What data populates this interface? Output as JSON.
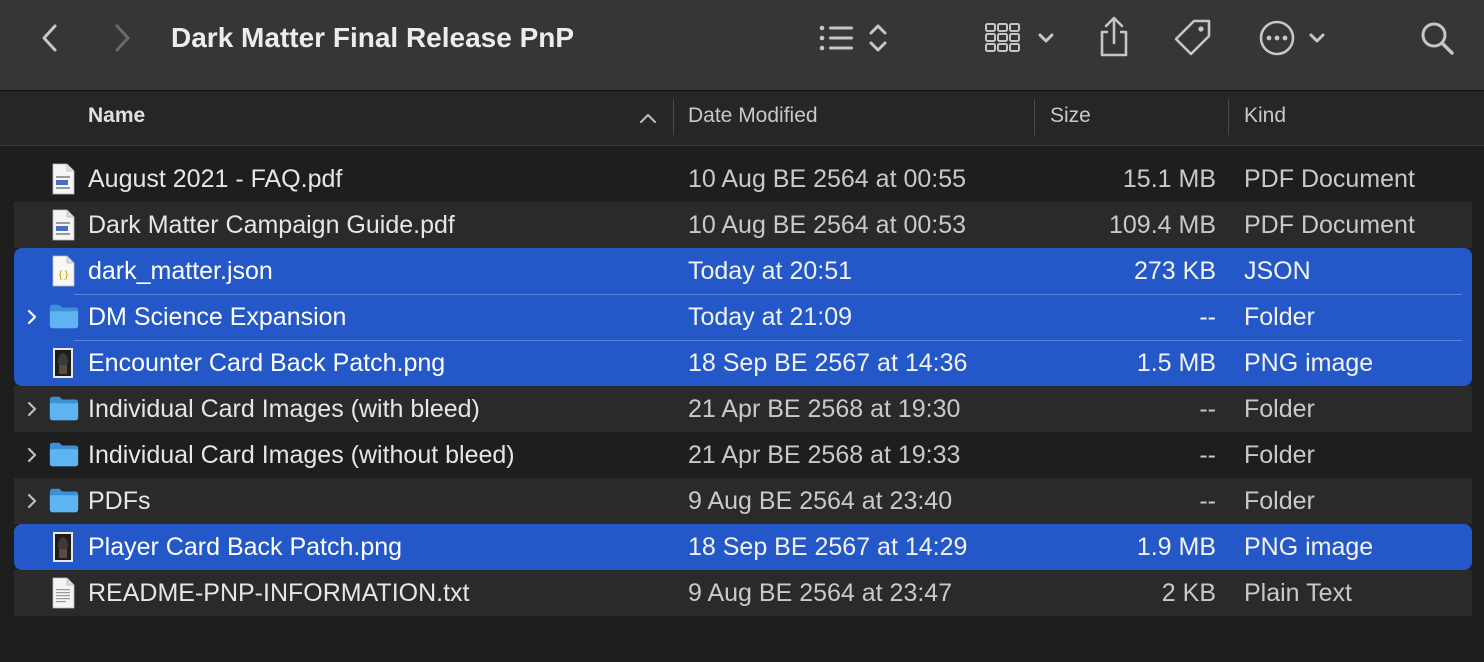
{
  "window": {
    "title": "Dark Matter Final Release PnP"
  },
  "toolbar": {
    "back_icon": "chevron-left-icon",
    "forward_icon": "chevron-right-icon",
    "view_list_icon": "list-icon",
    "grid_icon": "grid-icon",
    "share_icon": "share-icon",
    "tag_icon": "tag-icon",
    "more_icon": "ellipsis-circle-icon",
    "search_icon": "search-icon"
  },
  "columns": {
    "name": "Name",
    "date": "Date Modified",
    "size": "Size",
    "kind": "Kind"
  },
  "files": [
    {
      "name": "August 2021 - FAQ.pdf",
      "date": "10 Aug BE 2564 at 00:55",
      "size": "15.1 MB",
      "kind": "PDF Document",
      "icon": "pdf",
      "folder": false,
      "selected": false
    },
    {
      "name": "Dark Matter Campaign Guide.pdf",
      "date": "10 Aug BE 2564 at 00:53",
      "size": "109.4 MB",
      "kind": "PDF Document",
      "icon": "pdf",
      "folder": false,
      "selected": false
    },
    {
      "name": "dark_matter.json",
      "date": "Today at 20:51",
      "size": "273 KB",
      "kind": "JSON",
      "icon": "json",
      "folder": false,
      "selected": true
    },
    {
      "name": "DM Science Expansion",
      "date": "Today at 21:09",
      "size": "--",
      "kind": "Folder",
      "icon": "folder",
      "folder": true,
      "selected": true
    },
    {
      "name": "Encounter Card Back Patch.png",
      "date": "18 Sep BE 2567 at 14:36",
      "size": "1.5 MB",
      "kind": "PNG image",
      "icon": "image",
      "folder": false,
      "selected": true
    },
    {
      "name": "Individual Card Images (with bleed)",
      "date": "21 Apr BE 2568 at 19:30",
      "size": "--",
      "kind": "Folder",
      "icon": "folder",
      "folder": true,
      "selected": false
    },
    {
      "name": "Individual Card Images (without bleed)",
      "date": "21 Apr BE 2568 at 19:33",
      "size": "--",
      "kind": "Folder",
      "icon": "folder",
      "folder": true,
      "selected": false
    },
    {
      "name": "PDFs",
      "date": "9 Aug BE 2564 at 23:40",
      "size": "--",
      "kind": "Folder",
      "icon": "folder",
      "folder": true,
      "selected": false
    },
    {
      "name": "Player Card Back Patch.png",
      "date": "18 Sep BE 2567 at 14:29",
      "size": "1.9 MB",
      "kind": "PNG image",
      "icon": "image",
      "folder": false,
      "selected": true
    },
    {
      "name": "README-PNP-INFORMATION.txt",
      "date": "9 Aug BE 2564 at 23:47",
      "size": "2 KB",
      "kind": "Plain Text",
      "icon": "text",
      "folder": false,
      "selected": false
    }
  ],
  "colors": {
    "selection": "#2458c8",
    "toolbar": "#363636",
    "background": "#1e1e1e",
    "folder": "#4fa8e8"
  }
}
